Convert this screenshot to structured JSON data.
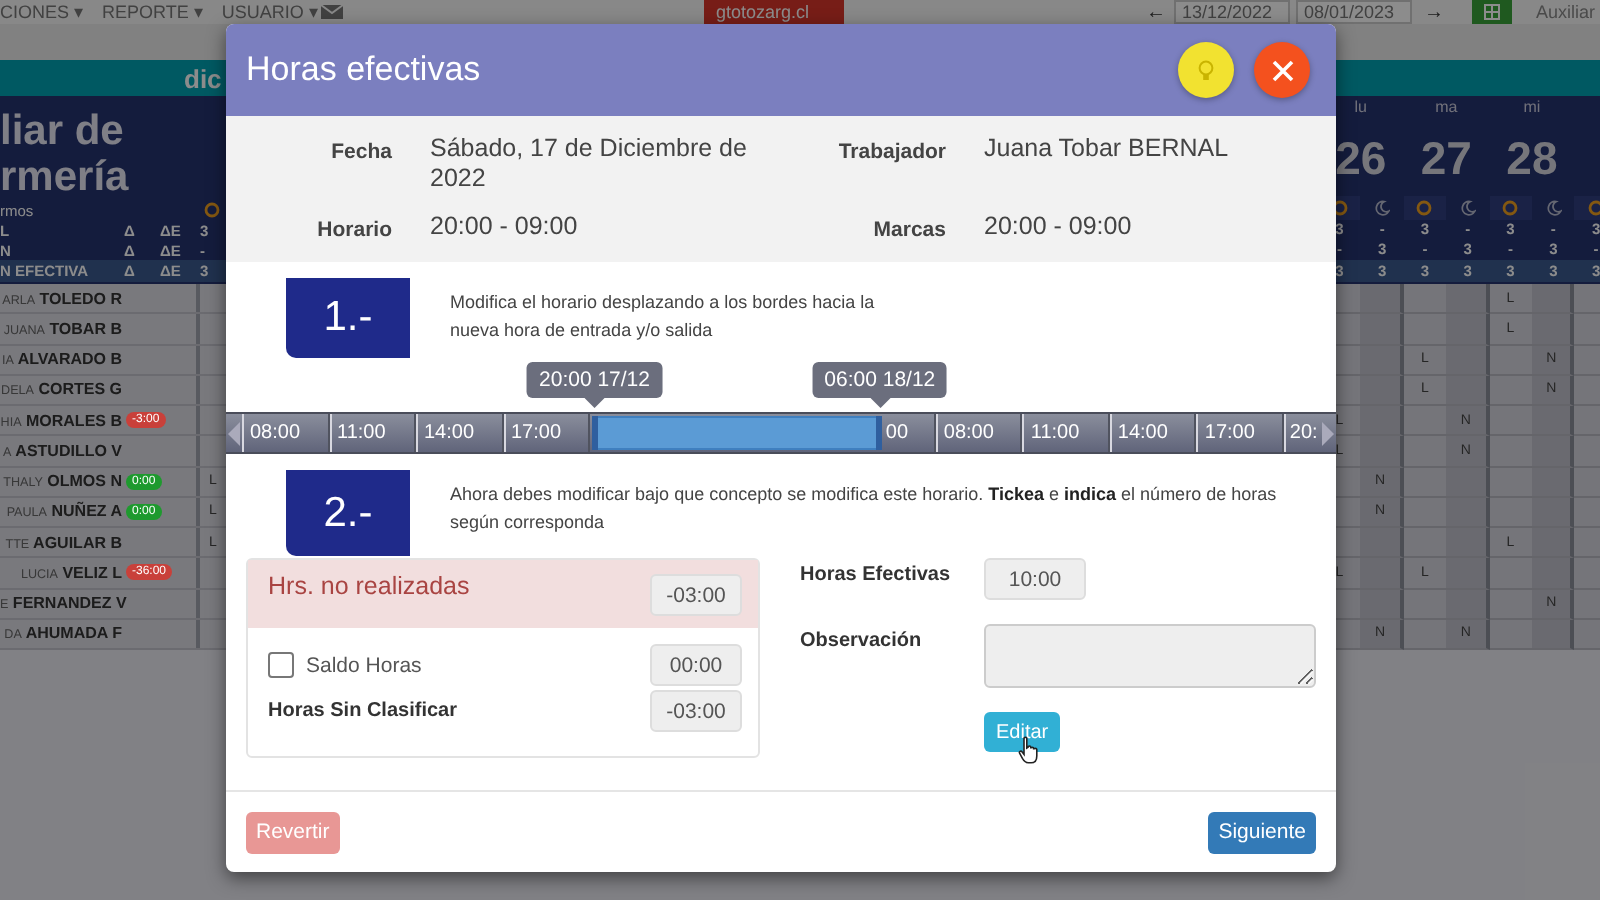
{
  "top_nav": {
    "menus": [
      "CIONES ▾",
      "REPORTE ▾",
      "USUARIO ▾"
    ],
    "site_badge": "gtotozarg.cl",
    "prev_arrow": "←",
    "date_from": "13/12/2022",
    "date_to": "08/01/2023",
    "next_arrow": "→",
    "user": "Auxiliar"
  },
  "schedule": {
    "month": "dic",
    "title": "liar de rmería",
    "shift_label": "rmos",
    "days": [
      {
        "weekday": "lu",
        "number": "26"
      },
      {
        "weekday": "ma",
        "number": "27"
      },
      {
        "weekday": "mi",
        "number": "28"
      }
    ],
    "shift_rows": [
      {
        "label": "L",
        "delta": "Δ",
        "delta_e": "ΔE",
        "value": "3",
        "values": [
          "3",
          "-",
          "3",
          "-",
          "3",
          "-",
          "3"
        ],
        "highlighted": false
      },
      {
        "label": "N",
        "delta": "Δ",
        "delta_e": "ΔE",
        "value": "-",
        "values": [
          "-",
          "3",
          "-",
          "3",
          "-",
          "3",
          "-"
        ],
        "highlighted": false
      },
      {
        "label": "N EFECTIVA",
        "delta": "Δ",
        "delta_e": "ΔE",
        "value": "3",
        "values": [
          "3",
          "3",
          "3",
          "3",
          "3",
          "3",
          "3"
        ],
        "highlighted": true
      }
    ],
    "workers": [
      {
        "first": "ARLA",
        "last": "TOLEDO R",
        "cells": [
          null,
          null,
          null,
          null,
          "L",
          null,
          null
        ]
      },
      {
        "first": "JUANA",
        "last": "TOBAR B",
        "cells": [
          null,
          null,
          null,
          null,
          "L",
          null,
          null
        ]
      },
      {
        "first": "IA",
        "last": "ALVARADO B",
        "cells": [
          null,
          null,
          "L",
          null,
          null,
          "N",
          null
        ]
      },
      {
        "first": "DELA",
        "last": "CORTES G",
        "cells": [
          null,
          null,
          "L",
          null,
          null,
          "N",
          null
        ]
      },
      {
        "first": "HIA",
        "last": "MORALES B",
        "badge": {
          "text": "-3:00",
          "color": "#c9403a"
        },
        "cells": [
          "L",
          null,
          null,
          "N",
          null,
          null,
          null
        ]
      },
      {
        "first": "A",
        "last": "ASTUDILLO V",
        "cells": [
          "L",
          null,
          null,
          "N",
          null,
          null,
          null
        ]
      },
      {
        "first": "THALY",
        "last": "OLMOS N",
        "badge": {
          "text": "0:00",
          "color": "#1e9a2e"
        },
        "side_cell": "L",
        "cells": [
          null,
          "N",
          null,
          null,
          null,
          null,
          null
        ]
      },
      {
        "first": "PAULA",
        "last": "NUÑEZ A",
        "badge": {
          "text": "0:00",
          "color": "#1e9a2e"
        },
        "side_cell": "L",
        "cells": [
          null,
          "N",
          null,
          null,
          null,
          null,
          null
        ]
      },
      {
        "first": "TTE",
        "last": "AGUILAR B",
        "side_cell": "L",
        "cells": [
          null,
          null,
          null,
          null,
          "L",
          null,
          null
        ]
      },
      {
        "first": "LUCIA",
        "last": "VELIZ L",
        "badge": {
          "text": "-36:00",
          "color": "#c9403a"
        },
        "cells": [
          "L",
          null,
          "L",
          null,
          null,
          null,
          null
        ]
      },
      {
        "first": "E",
        "last": "FERNANDEZ V",
        "cells": [
          null,
          null,
          null,
          null,
          null,
          "N",
          null
        ]
      },
      {
        "first": "DA",
        "last": "AHUMADA F",
        "cells": [
          null,
          "N",
          null,
          "N",
          null,
          null,
          null
        ]
      }
    ]
  },
  "modal": {
    "title": "Horas efectivas",
    "info": [
      {
        "label": "Fecha",
        "value": "Sábado, 17 de Diciembre de 2022"
      },
      {
        "label": "Trabajador",
        "value": "Juana Tobar BERNAL"
      },
      {
        "label": "Horario",
        "value": "20:00 - 09:00"
      },
      {
        "label": "Marcas",
        "value": "20:00 - 09:00"
      }
    ],
    "steps": [
      {
        "number": "1.-",
        "text": "Modifica el horario desplazando a los bordes hacia la nueva hora de entrada y/o salida"
      },
      {
        "number": "2.-",
        "text": "Ahora debes modificar bajo que concepto se modifica este horario. **Tickea** e **indica** el número de horas según corresponda"
      }
    ],
    "timeline": {
      "ticks_before": [
        "08:00",
        "11:00",
        "14:00",
        "17:00"
      ],
      "ticks_after": [
        "00",
        "08:00",
        "11:00",
        "14:00",
        "17:00",
        "20:"
      ],
      "handles": [
        {
          "label": "20:00 17/12",
          "level": 0.332
        },
        {
          "label": "06:00 18/12",
          "level": 0.589
        }
      ]
    },
    "not_done": {
      "label": "Hrs. no realizadas",
      "value": "-03:00"
    },
    "balance": {
      "label": "Saldo Horas",
      "checked": false,
      "value": "00:00"
    },
    "unclassified": {
      "label": "Horas Sin Clasificar",
      "value": "-03:00"
    },
    "effective": {
      "label": "Horas Efectivas",
      "value": "10:00"
    },
    "observation": {
      "label": "Observación"
    },
    "edit_button": "Editar",
    "footer": [
      {
        "label": "Revertir",
        "kind": "danger",
        "disabled": true
      },
      {
        "label": "Siguiente",
        "kind": "primary",
        "disabled": false
      }
    ]
  }
}
